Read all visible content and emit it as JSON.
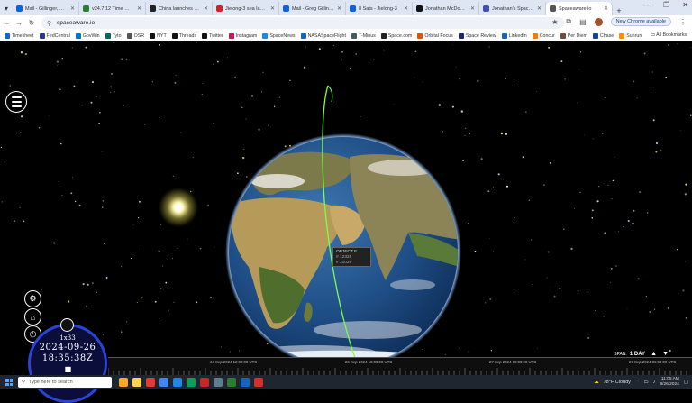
{
  "browser": {
    "tabs": [
      {
        "label": "Mail - Gillinger, Greg",
        "color": "#0a64d6"
      },
      {
        "label": "v24.7.12 Time — Tim",
        "color": "#2e7d32"
      },
      {
        "label": "China launches 10 s",
        "color": "#222222"
      },
      {
        "label": "Jielong-3 sea launch",
        "color": "#c62828"
      },
      {
        "label": "Mail - Greg Gillinger",
        "color": "#0a64d6"
      },
      {
        "label": "8 Sats - Jielong-3",
        "color": "#0a64d6"
      },
      {
        "label": "Jonathan McDowell",
        "color": "#111111"
      },
      {
        "label": "Jonathan's Space Re",
        "color": "#3f51b5"
      },
      {
        "label": "Spaceaware.io",
        "color": "#555555"
      }
    ],
    "url": "spaceaware.io",
    "new_chrome_label": "New Chrome available",
    "bookmarks": [
      {
        "label": "Timesheet",
        "color": "#1565c0"
      },
      {
        "label": "FedCentral",
        "color": "#283593"
      },
      {
        "label": "GovWin",
        "color": "#0277bd"
      },
      {
        "label": "Tyto",
        "color": "#00695c"
      },
      {
        "label": "OSR",
        "color": "#555555"
      },
      {
        "label": "NYT",
        "color": "#111111"
      },
      {
        "label": "Threads",
        "color": "#111111"
      },
      {
        "label": "Twitter",
        "color": "#111111"
      },
      {
        "label": "Instagram",
        "color": "#c2185b"
      },
      {
        "label": "SpaceNews",
        "color": "#1e88e5"
      },
      {
        "label": "NASASpaceFlight",
        "color": "#1565c0"
      },
      {
        "label": "T-Minus",
        "color": "#455a64"
      },
      {
        "label": "Space.com",
        "color": "#212121"
      },
      {
        "label": "Orbital Focus",
        "color": "#e65100"
      },
      {
        "label": "Space Review",
        "color": "#1a237e"
      },
      {
        "label": "LinkedIn",
        "color": "#0a66c2"
      },
      {
        "label": "Concur",
        "color": "#f57c00"
      },
      {
        "label": "Per Diem",
        "color": "#6d4c41"
      },
      {
        "label": "Chase",
        "color": "#0d47a1"
      },
      {
        "label": "Sunrun",
        "color": "#ff8f00"
      }
    ],
    "all_bookmarks_label": "All Bookmarks"
  },
  "app": {
    "tooltip": {
      "name": "OBJECT F",
      "line2": "# 12325",
      "line3": "# 31025"
    },
    "clock": {
      "rate": "1x33",
      "date": "2024-09-26",
      "time": "18:35:38Z",
      "pause_glyph": "▮▮"
    },
    "span": {
      "label": "SPAN:",
      "value": "1 DAY"
    },
    "timeline_labels": [
      "24 Sep 2024 12:00:00 UTC",
      "26 Sep 2024 18:00:00 UTC",
      "27 Sep 2024 00:00:00 UTC",
      "27 Sep 2024 06:00:00 UTC"
    ],
    "colors": {
      "orbit": "#7dff4a",
      "clock_ring": "#2a44d8",
      "ocean": "#1f4e86"
    }
  },
  "taskbar": {
    "search_placeholder": "Type here to search",
    "apps": [
      "#f9a825",
      "#ffd54f",
      "#e53935",
      "#4285f4",
      "#1e88e5",
      "#0f9d58",
      "#c62828",
      "#607d8b",
      "#2e7d32",
      "#1565c0",
      "#d32f2f"
    ],
    "weather": "78°F  Cloudy",
    "time": "11:05 AM",
    "date": "9/26/2024"
  }
}
